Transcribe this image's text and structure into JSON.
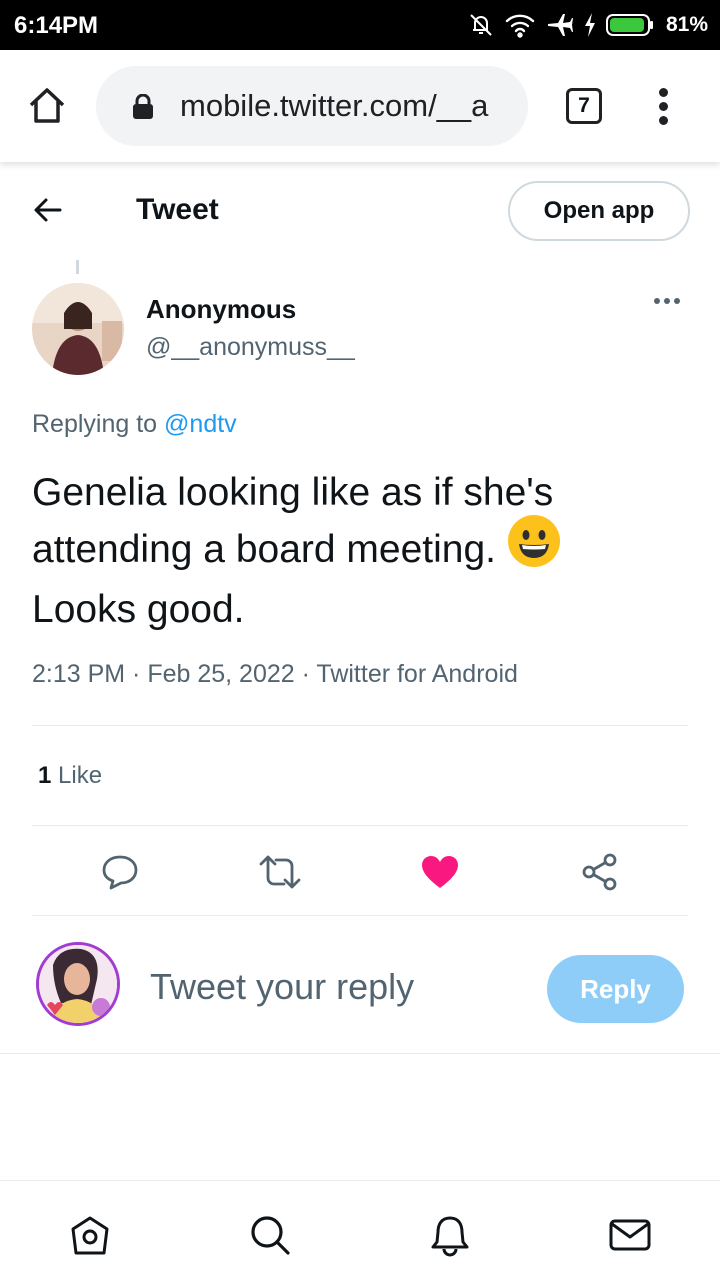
{
  "status_bar": {
    "time": "6:14PM",
    "battery": "81%",
    "icons": [
      "alarm-off-icon",
      "wifi-icon",
      "airplane-icon",
      "charging-icon",
      "battery-icon"
    ]
  },
  "browser": {
    "url": "mobile.twitter.com/__a",
    "tab_count": "7",
    "icons": [
      "home-icon",
      "lock-icon",
      "tabs-icon",
      "overflow-menu-icon"
    ]
  },
  "header": {
    "title": "Tweet",
    "open_app": "Open app"
  },
  "tweet": {
    "author_name": "Anonymous",
    "author_handle": "@__anonymuss__",
    "replying_prefix": "Replying to ",
    "replying_to": "@ndtv",
    "text_line1": "Genelia looking like as if she's",
    "text_line2": "attending a board meeting.",
    "text_line3": "Looks good.",
    "emoji": "grinning-face",
    "meta": "2:13 PM · Feb 25, 2022 · Twitter for Android",
    "like_count": "1",
    "like_label": " Like",
    "liked": true
  },
  "composer": {
    "placeholder": "Tweet your reply",
    "reply_label": "Reply"
  },
  "colors": {
    "accent": "#1d9bf0",
    "like": "#f91880",
    "reply_button_disabled": "#8ecdf7",
    "secondary_text": "#536471"
  },
  "bottom_nav": [
    "home-icon",
    "search-icon",
    "notifications-icon",
    "messages-icon"
  ]
}
